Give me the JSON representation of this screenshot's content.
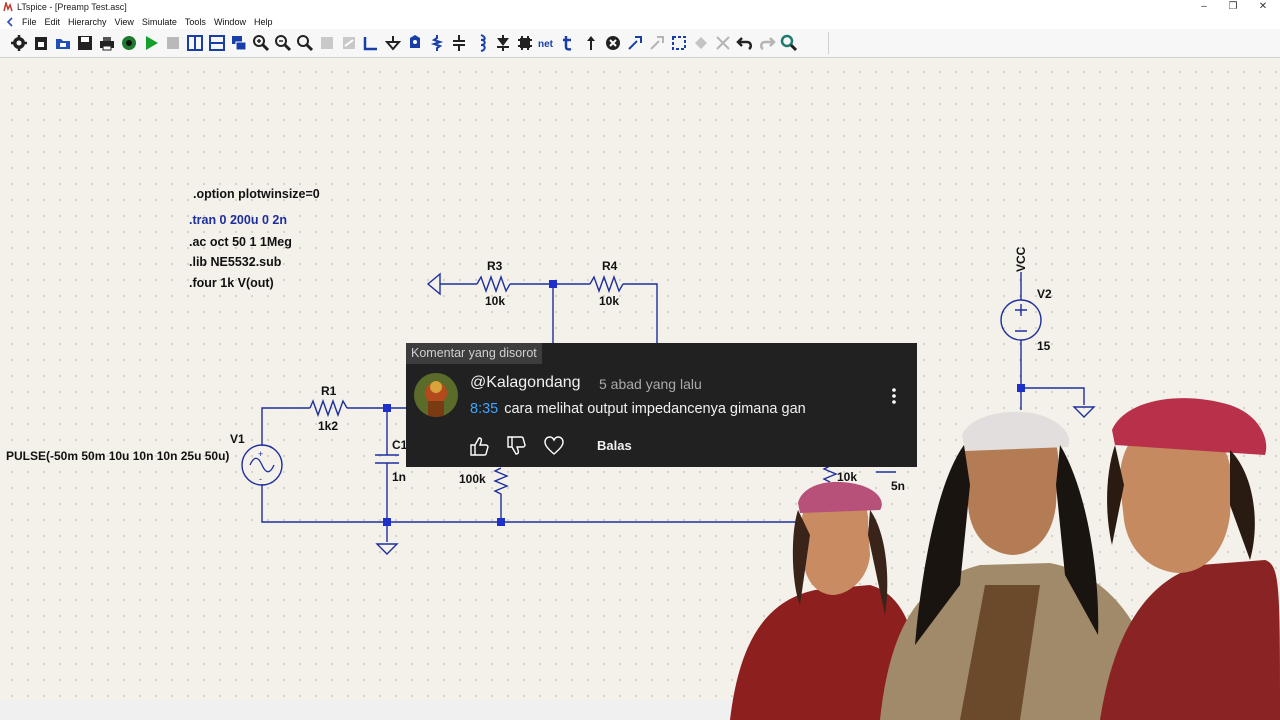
{
  "window": {
    "title": "LTspice - [Preamp Test.asc]"
  },
  "menu": [
    "File",
    "Edit",
    "Hierarchy",
    "View",
    "Simulate",
    "Tools",
    "Window",
    "Help"
  ],
  "toolbar": {
    "icons": [
      "settings-icon",
      "open-icon",
      "open-folder-icon",
      "save-icon",
      "print-icon",
      "control-panel-icon",
      "run-icon",
      "halt-icon",
      "tile-vertical-icon",
      "tile-horizontal-icon",
      "cascade-icon",
      "zoom-in-icon",
      "zoom-out-icon",
      "zoom-fit-icon",
      "zoom-back-icon",
      "autorange-icon",
      "wire-icon",
      "ground-icon",
      "label-net-icon",
      "resistor-icon",
      "capacitor-icon",
      "inductor-icon",
      "diode-icon",
      "component-icon",
      "net-icon",
      "text-icon",
      "move-icon",
      "drag-icon",
      "delete-icon",
      "copy-icon",
      "paste-icon",
      "mirror-icon",
      "rotate-icon",
      "undo-icon",
      "redo-icon",
      "find-icon"
    ]
  },
  "schematic": {
    "directives": [
      ".option plotwinsize=0",
      ".tran 0 200u 0 2n",
      ".ac oct 50 1 1Meg",
      ".lib NE5532.sub",
      ".four 1k V(out)"
    ],
    "labels": {
      "r3_name": "R3",
      "r3_value": "10k",
      "r4_name": "R4",
      "r4_value": "10k",
      "r1_name": "R1",
      "r1_value": "1k2",
      "c1_name": "C1",
      "c1_value": "1n",
      "v1_name": "V1",
      "v1_value": "PULSE(-50m 50m 10u 10n 10n 25u 50u)",
      "r_mid_value": "100k",
      "r_right_value": "10k",
      "c_right_value": "5n",
      "vcc_label": "VCC",
      "v2_name": "V2",
      "v2_value": "15"
    }
  },
  "comment": {
    "header": "Komentar yang disorot",
    "author": "@Kalagondang",
    "time_ago": "5 abad yang lalu",
    "timestamp": "8:35",
    "text": "cara melihat output impedancenya gimana gan",
    "reply_label": "Balas"
  },
  "colors": {
    "wire": "#1e2f9c",
    "node": "#1f30c8",
    "card_bg": "#212121",
    "timestamp_link": "#3ea6ff"
  }
}
